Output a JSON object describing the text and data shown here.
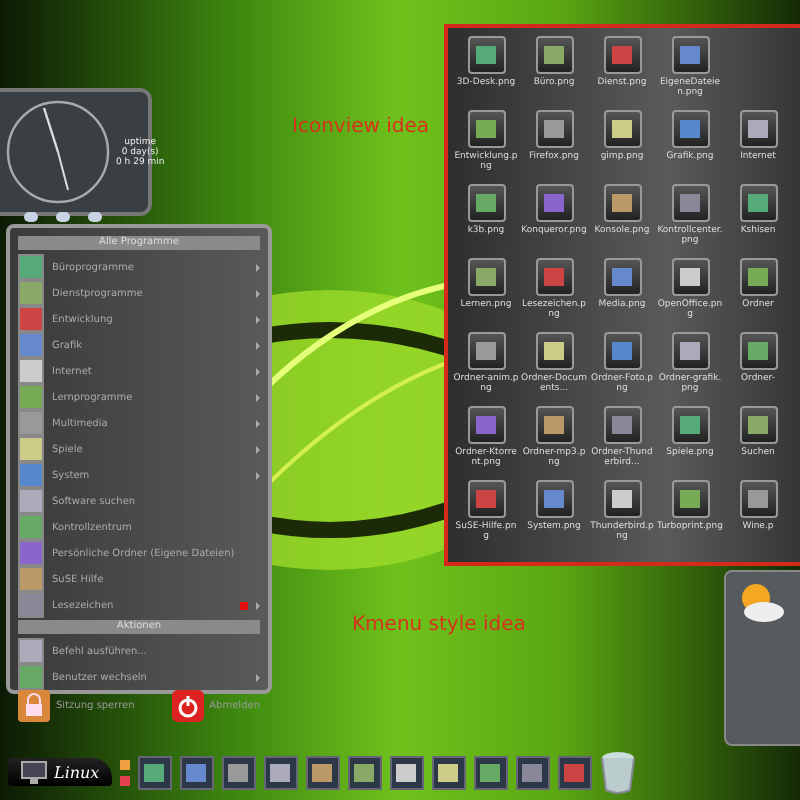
{
  "desktop_labels": [
    {
      "kind": "iconview",
      "text": "Iconview idea"
    },
    {
      "kind": "kmenu",
      "text": "Kmenu style idea"
    }
  ],
  "clock_widget": {
    "lines": [
      "uptime",
      "0 day(s)",
      "0 h 29 min"
    ]
  },
  "start_menu": {
    "header": "Alle Programme",
    "items": [
      {
        "label": "Büroprogramme",
        "has_submenu": true,
        "flagged": false
      },
      {
        "label": "Dienstprogramme",
        "has_submenu": true,
        "flagged": false
      },
      {
        "label": "Entwicklung",
        "has_submenu": true,
        "flagged": false
      },
      {
        "label": "Grafik",
        "has_submenu": true,
        "flagged": false
      },
      {
        "label": "Internet",
        "has_submenu": true,
        "flagged": false
      },
      {
        "label": "Lernprogramme",
        "has_submenu": true,
        "flagged": false
      },
      {
        "label": "Multimedia",
        "has_submenu": true,
        "flagged": false
      },
      {
        "label": "Spiele",
        "has_submenu": true,
        "flagged": false
      },
      {
        "label": "System",
        "has_submenu": true,
        "flagged": false
      },
      {
        "label": "Software suchen",
        "has_submenu": false,
        "flagged": false
      },
      {
        "label": "Kontrollzentrum",
        "has_submenu": false,
        "flagged": false
      },
      {
        "label": "Persönliche Ordner (Eigene Dateien)",
        "has_submenu": false,
        "flagged": false
      },
      {
        "label": "SuSE Hilfe",
        "has_submenu": false,
        "flagged": false
      },
      {
        "label": "Lesezeichen",
        "has_submenu": true,
        "flagged": true
      }
    ],
    "actions_header": "Aktionen",
    "actions": [
      {
        "label": "Befehl ausführen...",
        "has_submenu": false
      },
      {
        "label": "Benutzer wechseln",
        "has_submenu": true
      }
    ],
    "bottom_buttons": [
      {
        "kind": "lock",
        "label": "Sitzung sperren"
      },
      {
        "kind": "power",
        "label": "Abmelden"
      }
    ]
  },
  "icon_view": {
    "rows": [
      [
        "3D-Desk.png",
        "Büro.png",
        "Dienst.png",
        "EigeneDateien.png"
      ],
      [
        "Entwicklung.png",
        "Firefox.png",
        "gimp.png",
        "Grafik.png",
        "Internet"
      ],
      [
        "k3b.png",
        "Konqueror.png",
        "Konsole.png",
        "Kontrollcenter.png",
        "Kshisen"
      ],
      [
        "Lernen.png",
        "Lesezeichen.png",
        "Media.png",
        "OpenOffice.png",
        "Ordner"
      ],
      [
        "Ordner-anim.png",
        "Ordner-Documents...",
        "Ordner-Foto.png",
        "Ordner-grafik.png",
        "Ordner-"
      ],
      [
        "Ordner-Ktorrent.png",
        "Ordner-mp3.png",
        "Ordner-Thunderbird...",
        "Spiele.png",
        "Suchen"
      ],
      [
        "SuSE-Hilfe.png",
        "System.png",
        "Thunderbird.png",
        "Turboprint.png",
        "Wine.p"
      ]
    ]
  },
  "taskbar": {
    "logo": "Linux"
  }
}
